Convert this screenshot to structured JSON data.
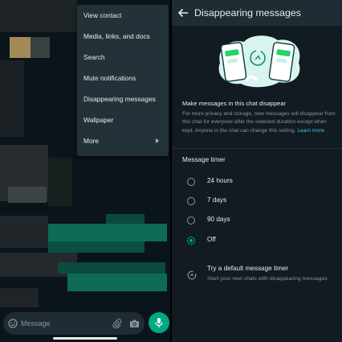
{
  "menu": {
    "items": [
      {
        "label": "View contact"
      },
      {
        "label": "Media, links, and docs"
      },
      {
        "label": "Search"
      },
      {
        "label": "Mute notifications"
      },
      {
        "label": "Disappearing messages"
      },
      {
        "label": "Wallpaper"
      },
      {
        "label": "More",
        "submenu": true
      }
    ]
  },
  "composer": {
    "placeholder": "Message"
  },
  "icons": {
    "emoji": "emoji-icon",
    "attach": "paperclip-icon",
    "camera": "camera-icon",
    "mic": "mic-icon",
    "back": "back-arrow-icon",
    "timer": "timer-icon"
  },
  "colors": {
    "accent": "#00a884",
    "link": "#53bdeb",
    "menu_bg": "#233138",
    "panel_bg": "#111b21"
  },
  "settings": {
    "title": "Disappearing messages",
    "heading": "Make messages in this chat disappear",
    "description": "For more privacy and storage, new messages will disappear from this chat for everyone after the selected duration except when kept. Anyone in the chat can change this setting.",
    "learn_more": "Learn more",
    "timer_title": "Message timer",
    "options": [
      {
        "label": "24 hours",
        "selected": false
      },
      {
        "label": "7 days",
        "selected": false
      },
      {
        "label": "90 days",
        "selected": false
      },
      {
        "label": "Off",
        "selected": true
      }
    ],
    "default_timer": {
      "title": "Try a default message timer",
      "subtitle": "Start your new chats with disappearing messages"
    }
  }
}
